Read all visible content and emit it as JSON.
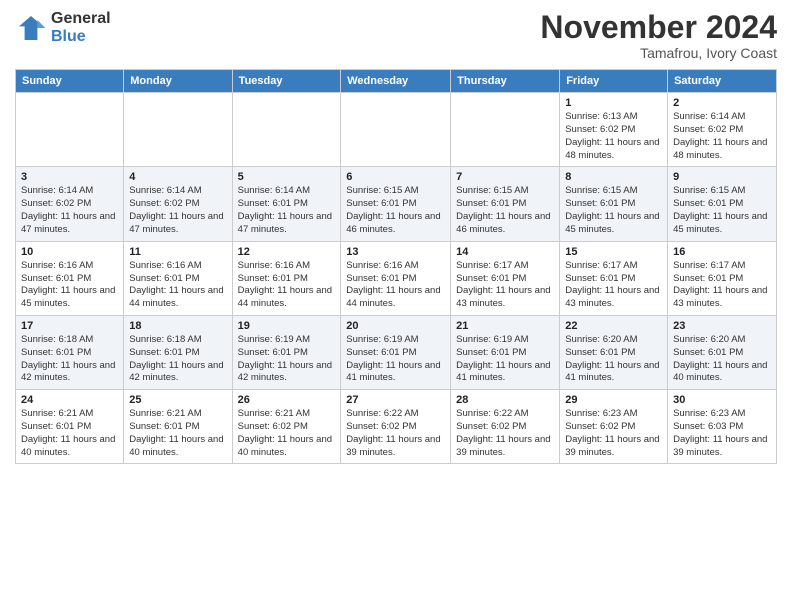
{
  "header": {
    "logo_general": "General",
    "logo_blue": "Blue",
    "month_title": "November 2024",
    "location": "Tamafrou, Ivory Coast"
  },
  "days_of_week": [
    "Sunday",
    "Monday",
    "Tuesday",
    "Wednesday",
    "Thursday",
    "Friday",
    "Saturday"
  ],
  "weeks": [
    [
      {
        "day": "",
        "info": ""
      },
      {
        "day": "",
        "info": ""
      },
      {
        "day": "",
        "info": ""
      },
      {
        "day": "",
        "info": ""
      },
      {
        "day": "",
        "info": ""
      },
      {
        "day": "1",
        "info": "Sunrise: 6:13 AM\nSunset: 6:02 PM\nDaylight: 11 hours and 48 minutes."
      },
      {
        "day": "2",
        "info": "Sunrise: 6:14 AM\nSunset: 6:02 PM\nDaylight: 11 hours and 48 minutes."
      }
    ],
    [
      {
        "day": "3",
        "info": "Sunrise: 6:14 AM\nSunset: 6:02 PM\nDaylight: 11 hours and 47 minutes."
      },
      {
        "day": "4",
        "info": "Sunrise: 6:14 AM\nSunset: 6:02 PM\nDaylight: 11 hours and 47 minutes."
      },
      {
        "day": "5",
        "info": "Sunrise: 6:14 AM\nSunset: 6:01 PM\nDaylight: 11 hours and 47 minutes."
      },
      {
        "day": "6",
        "info": "Sunrise: 6:15 AM\nSunset: 6:01 PM\nDaylight: 11 hours and 46 minutes."
      },
      {
        "day": "7",
        "info": "Sunrise: 6:15 AM\nSunset: 6:01 PM\nDaylight: 11 hours and 46 minutes."
      },
      {
        "day": "8",
        "info": "Sunrise: 6:15 AM\nSunset: 6:01 PM\nDaylight: 11 hours and 45 minutes."
      },
      {
        "day": "9",
        "info": "Sunrise: 6:15 AM\nSunset: 6:01 PM\nDaylight: 11 hours and 45 minutes."
      }
    ],
    [
      {
        "day": "10",
        "info": "Sunrise: 6:16 AM\nSunset: 6:01 PM\nDaylight: 11 hours and 45 minutes."
      },
      {
        "day": "11",
        "info": "Sunrise: 6:16 AM\nSunset: 6:01 PM\nDaylight: 11 hours and 44 minutes."
      },
      {
        "day": "12",
        "info": "Sunrise: 6:16 AM\nSunset: 6:01 PM\nDaylight: 11 hours and 44 minutes."
      },
      {
        "day": "13",
        "info": "Sunrise: 6:16 AM\nSunset: 6:01 PM\nDaylight: 11 hours and 44 minutes."
      },
      {
        "day": "14",
        "info": "Sunrise: 6:17 AM\nSunset: 6:01 PM\nDaylight: 11 hours and 43 minutes."
      },
      {
        "day": "15",
        "info": "Sunrise: 6:17 AM\nSunset: 6:01 PM\nDaylight: 11 hours and 43 minutes."
      },
      {
        "day": "16",
        "info": "Sunrise: 6:17 AM\nSunset: 6:01 PM\nDaylight: 11 hours and 43 minutes."
      }
    ],
    [
      {
        "day": "17",
        "info": "Sunrise: 6:18 AM\nSunset: 6:01 PM\nDaylight: 11 hours and 42 minutes."
      },
      {
        "day": "18",
        "info": "Sunrise: 6:18 AM\nSunset: 6:01 PM\nDaylight: 11 hours and 42 minutes."
      },
      {
        "day": "19",
        "info": "Sunrise: 6:19 AM\nSunset: 6:01 PM\nDaylight: 11 hours and 42 minutes."
      },
      {
        "day": "20",
        "info": "Sunrise: 6:19 AM\nSunset: 6:01 PM\nDaylight: 11 hours and 41 minutes."
      },
      {
        "day": "21",
        "info": "Sunrise: 6:19 AM\nSunset: 6:01 PM\nDaylight: 11 hours and 41 minutes."
      },
      {
        "day": "22",
        "info": "Sunrise: 6:20 AM\nSunset: 6:01 PM\nDaylight: 11 hours and 41 minutes."
      },
      {
        "day": "23",
        "info": "Sunrise: 6:20 AM\nSunset: 6:01 PM\nDaylight: 11 hours and 40 minutes."
      }
    ],
    [
      {
        "day": "24",
        "info": "Sunrise: 6:21 AM\nSunset: 6:01 PM\nDaylight: 11 hours and 40 minutes."
      },
      {
        "day": "25",
        "info": "Sunrise: 6:21 AM\nSunset: 6:01 PM\nDaylight: 11 hours and 40 minutes."
      },
      {
        "day": "26",
        "info": "Sunrise: 6:21 AM\nSunset: 6:02 PM\nDaylight: 11 hours and 40 minutes."
      },
      {
        "day": "27",
        "info": "Sunrise: 6:22 AM\nSunset: 6:02 PM\nDaylight: 11 hours and 39 minutes."
      },
      {
        "day": "28",
        "info": "Sunrise: 6:22 AM\nSunset: 6:02 PM\nDaylight: 11 hours and 39 minutes."
      },
      {
        "day": "29",
        "info": "Sunrise: 6:23 AM\nSunset: 6:02 PM\nDaylight: 11 hours and 39 minutes."
      },
      {
        "day": "30",
        "info": "Sunrise: 6:23 AM\nSunset: 6:03 PM\nDaylight: 11 hours and 39 minutes."
      }
    ]
  ]
}
